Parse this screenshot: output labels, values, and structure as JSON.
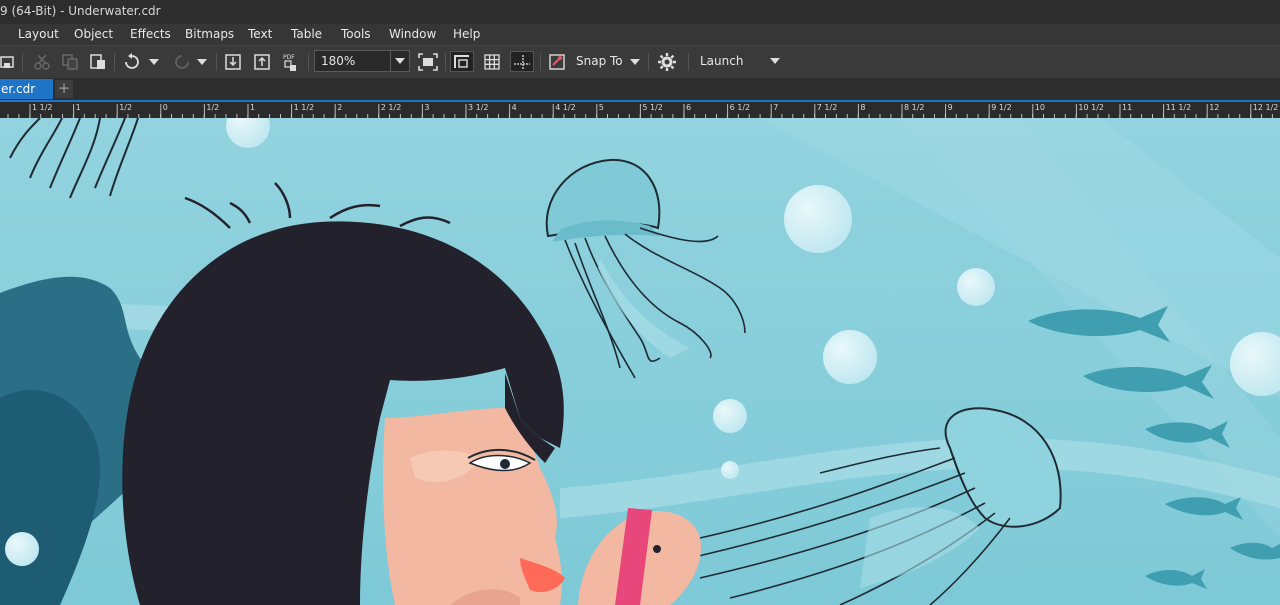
{
  "window": {
    "title": "9 (64-Bit) - Underwater.cdr"
  },
  "menu": [
    "Layout",
    "Object",
    "Effects",
    "Bitmaps",
    "Text",
    "Table",
    "Tools",
    "Window",
    "Help"
  ],
  "toolbar": {
    "zoom_value": "180%",
    "snap_label": "Snap To",
    "launch_label": "Launch"
  },
  "tabs": {
    "document": "er.cdr"
  },
  "ruler": {
    "labels": [
      "1 1/2",
      "1",
      "1/2",
      "0",
      "1/2",
      "1",
      "1 1/2",
      "2",
      "2 1/2",
      "3",
      "3 1/2",
      "4",
      "4 1/2",
      "5",
      "5 1/2",
      "6",
      "6 1/2",
      "7",
      "7 1/2",
      "8",
      "8 1/2",
      "9",
      "9 1/2",
      "10",
      "10 1/2",
      "11",
      "11 1/2",
      "12",
      "12 1/2"
    ]
  },
  "colors": {
    "accent": "#1e74c6",
    "water": "#8fd0dd",
    "hair": "#23222c",
    "skin": "#f2b8a2"
  }
}
